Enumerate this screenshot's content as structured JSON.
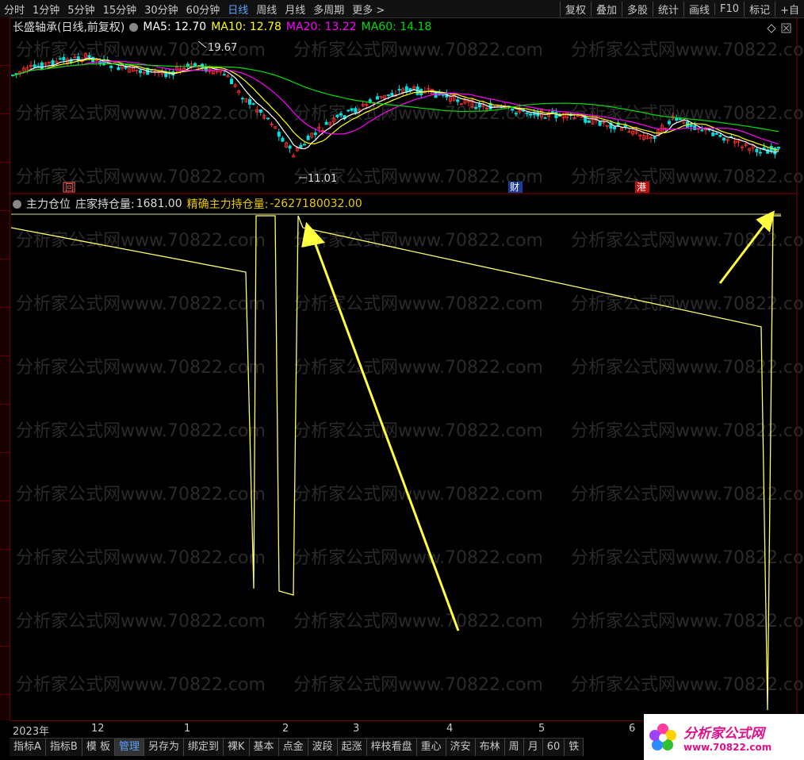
{
  "toolbar": {
    "tabs": [
      "分时",
      "1分钟",
      "5分钟",
      "15分钟",
      "30分钟",
      "60分钟",
      "日线",
      "周线",
      "月线",
      "多周期",
      "更多 >"
    ],
    "active_tab": "日线",
    "right_buttons": [
      "复权",
      "叠加",
      "多股",
      "统计",
      "画线",
      "F10",
      "标记",
      "+自"
    ]
  },
  "chart_title": {
    "stock": "长盛轴承(日线,前复权)",
    "ma5": "MA5: 12.70",
    "ma10": "MA10: 12.78",
    "ma20": "MA20: 13.22",
    "ma60": "MA60: 14.18",
    "ma5_color": "#ffffff",
    "ma10_color": "#ffff00",
    "ma20_color": "#ff00ff",
    "ma60_color": "#00dd00"
  },
  "price_annotations": {
    "high": "19.67",
    "low": "11.01",
    "markers": [
      "回",
      "财",
      "港"
    ]
  },
  "indicator": {
    "name": "主力仓位",
    "label1": "庄家持仓量:",
    "value1": "1681.00",
    "label2": "精确主力持仓量:",
    "value2": "-2627180032.00",
    "line_color": "#ffff66"
  },
  "date_axis": [
    "2023年",
    "12",
    "1",
    "2",
    "3",
    "4",
    "5",
    "6"
  ],
  "bottom_tabs": [
    "指标A",
    "指标B",
    "模 板",
    "管理",
    "另存为",
    "绑定到",
    "裸K",
    "基本",
    "点金",
    "波段",
    "起涨",
    "梓枝看盘",
    "重心",
    "济安",
    "布林",
    "周",
    "月",
    "60",
    "铁"
  ],
  "active_bottom_tab": "管理",
  "watermark": "分析家公式网www.70822.com",
  "logo": {
    "title": "分析家公式网",
    "url": "www.70822.com"
  },
  "colors": {
    "up": "#ff3030",
    "down": "#00e0e0",
    "grid_border": "#8b0000"
  }
}
